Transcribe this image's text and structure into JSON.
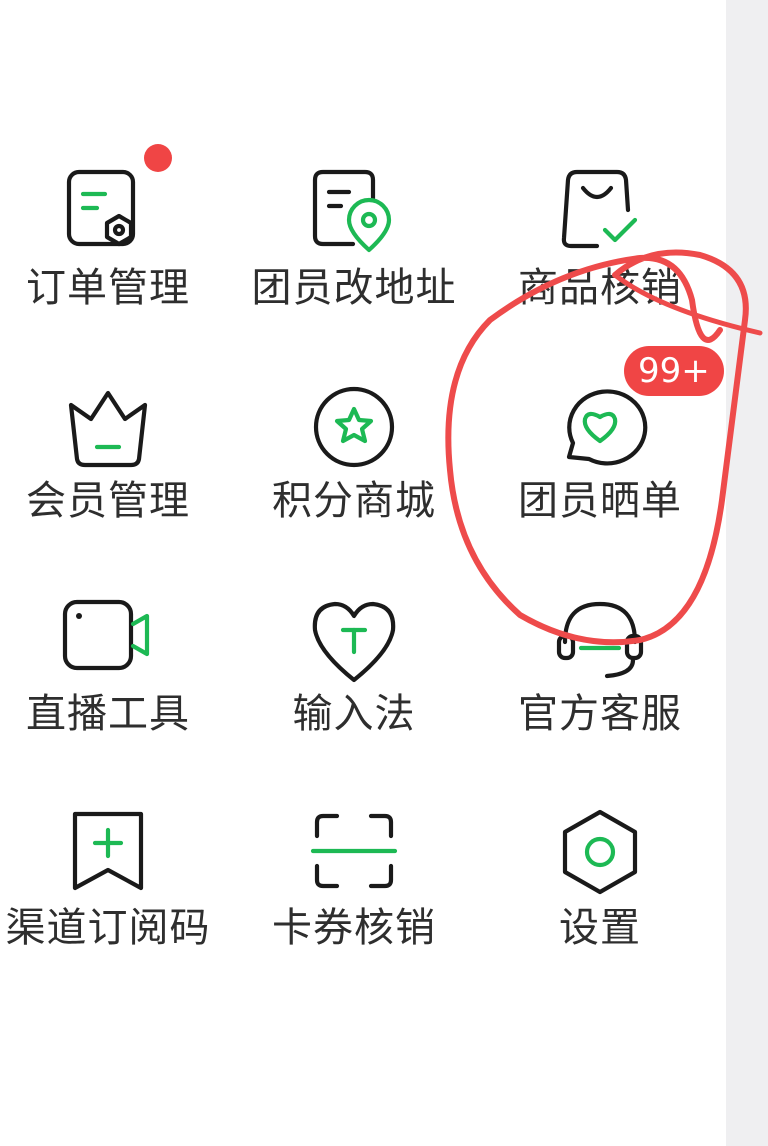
{
  "grid": {
    "items": [
      {
        "label": "订单管理",
        "icon": "order-manage-icon"
      },
      {
        "label": "团员改地址",
        "icon": "address-change-icon"
      },
      {
        "label": "商品核销",
        "icon": "shopping-bag-check-icon"
      },
      {
        "label": "会员管理",
        "icon": "crown-icon"
      },
      {
        "label": "积分商城",
        "icon": "star-circle-icon"
      },
      {
        "label": "团员晒单",
        "icon": "heart-chat-icon"
      },
      {
        "label": "直播工具",
        "icon": "video-camera-icon"
      },
      {
        "label": "输入法",
        "icon": "heart-t-icon"
      },
      {
        "label": "官方客服",
        "icon": "headset-icon"
      },
      {
        "label": "渠道订阅码",
        "icon": "bookmark-plus-icon"
      },
      {
        "label": "卡券核销",
        "icon": "scan-icon"
      },
      {
        "label": "设置",
        "icon": "hexagon-settings-icon"
      }
    ]
  },
  "badges": {
    "sharing_count": "99+"
  },
  "colors": {
    "accent": "#1db954",
    "badge": "#f04545",
    "annotation": "#ee4b4b"
  }
}
